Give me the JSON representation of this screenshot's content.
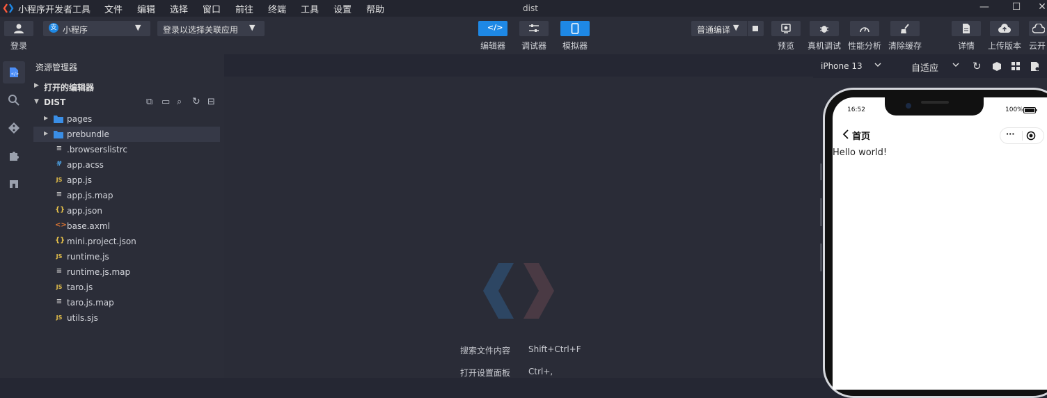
{
  "titlebar": {
    "app_name": "小程序开发者工具",
    "menus": [
      "文件",
      "编辑",
      "选择",
      "窗口",
      "前往",
      "终端",
      "工具",
      "设置",
      "帮助"
    ],
    "window_title": "dist",
    "minimize": "—",
    "maximize": "☐",
    "close": "✕"
  },
  "toolbar": {
    "login_label": "登录",
    "project_type": "小程序",
    "associate_app": "登录以选择关联应用",
    "modes": [
      {
        "label": "编辑器",
        "active": true
      },
      {
        "label": "调试器",
        "active": false
      },
      {
        "label": "模拟器",
        "active": true
      }
    ],
    "compile_mode": "普通编译",
    "actions": [
      "预览",
      "真机调试",
      "性能分析",
      "清除缓存",
      "详情",
      "上传版本",
      "云开"
    ]
  },
  "explorer": {
    "title": "资源管理器",
    "open_editors": "打开的编辑器",
    "root": "DIST",
    "files": [
      {
        "name": "pages",
        "type": "folder"
      },
      {
        "name": "prebundle",
        "type": "folder"
      },
      {
        "name": ".browserslistrc",
        "type": "text",
        "icon": "≡"
      },
      {
        "name": "app.acss",
        "type": "css",
        "icon": "#"
      },
      {
        "name": "app.js",
        "type": "js",
        "icon": "JS"
      },
      {
        "name": "app.js.map",
        "type": "text",
        "icon": "≡"
      },
      {
        "name": "app.json",
        "type": "json",
        "icon": "{}"
      },
      {
        "name": "base.axml",
        "type": "xml",
        "icon": "<>"
      },
      {
        "name": "mini.project.json",
        "type": "json",
        "icon": "{}"
      },
      {
        "name": "runtime.js",
        "type": "js",
        "icon": "JS"
      },
      {
        "name": "runtime.js.map",
        "type": "text",
        "icon": "≡"
      },
      {
        "name": "taro.js",
        "type": "js",
        "icon": "JS"
      },
      {
        "name": "taro.js.map",
        "type": "text",
        "icon": "≡"
      },
      {
        "name": "utils.sjs",
        "type": "js",
        "icon": "JS"
      }
    ]
  },
  "editor": {
    "shortcuts": [
      {
        "label": "搜索文件内容",
        "keys": "Shift+Ctrl+F"
      },
      {
        "label": "打开设置面板",
        "keys": "Ctrl+,"
      }
    ]
  },
  "simulator": {
    "device": "iPhone 13",
    "zoom": "自适应",
    "status_time": "16:52",
    "battery": "100%",
    "nav_title": "首页",
    "more": "···",
    "content": "Hello world!"
  },
  "colors": {
    "accent": "#1e88e5",
    "bg": "#252733",
    "panel": "#2b2d38"
  }
}
